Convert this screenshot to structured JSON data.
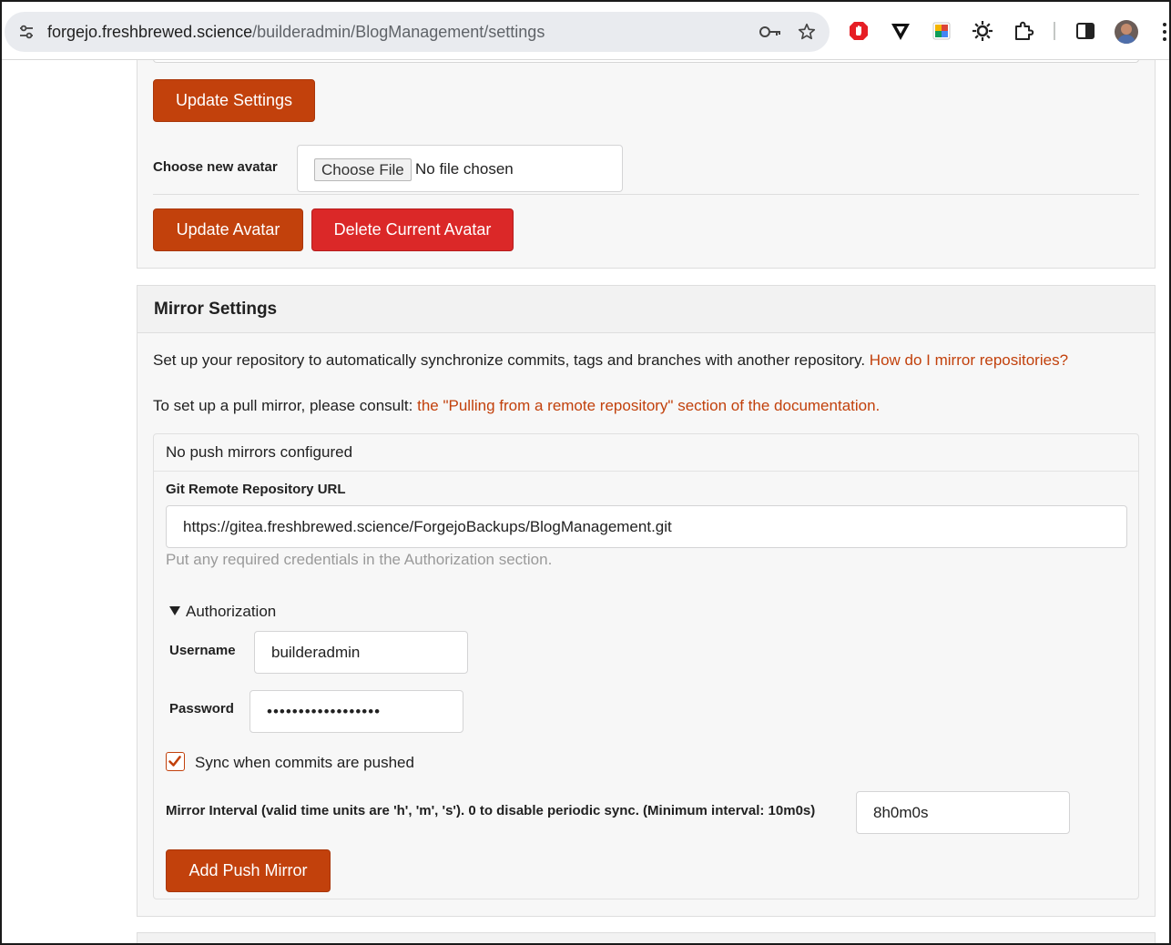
{
  "browser": {
    "url_host": "forgejo.freshbrewed.science",
    "url_path": "/builderadmin/BlogManagement/settings",
    "extensions": [
      "adblock-icon",
      "vivaldi-icon",
      "color-picker-icon",
      "sun-icon",
      "puzzle-icon"
    ]
  },
  "avatar_section": {
    "update_settings_label": "Update Settings",
    "choose_avatar_label": "Choose new avatar",
    "choose_file_label": "Choose File",
    "file_status": "No file chosen",
    "update_avatar_label": "Update Avatar",
    "delete_avatar_label": "Delete Current Avatar"
  },
  "mirror": {
    "title": "Mirror Settings",
    "description": "Set up your repository to automatically synchronize commits, tags and branches with another repository.",
    "help_link": "How do I mirror repositories?",
    "pull_text": "To set up a pull mirror, please consult:",
    "pull_link": "the \"Pulling from a remote repository\" section of the documentation.",
    "no_push_mirrors": "No push mirrors configured",
    "remote_url_label": "Git Remote Repository URL",
    "remote_url_value": "https://gitea.freshbrewed.science/ForgejoBackups/BlogManagement.git",
    "remote_url_help": "Put any required credentials in the Authorization section.",
    "authorization_label": "Authorization",
    "username_label": "Username",
    "username_value": "builderadmin",
    "password_label": "Password",
    "password_value": "••••••••••••••••••",
    "sync_label": "Sync when commits are pushed",
    "sync_checked": true,
    "interval_label": "Mirror Interval (valid time units are 'h', 'm', 's'). 0 to disable periodic sync. (Minimum interval: 10m0s)",
    "interval_value": "8h0m0s",
    "add_push_mirror_label": "Add Push Mirror"
  },
  "colors": {
    "primary": "#c2410c",
    "danger": "#db2828",
    "link": "#c2410c"
  }
}
